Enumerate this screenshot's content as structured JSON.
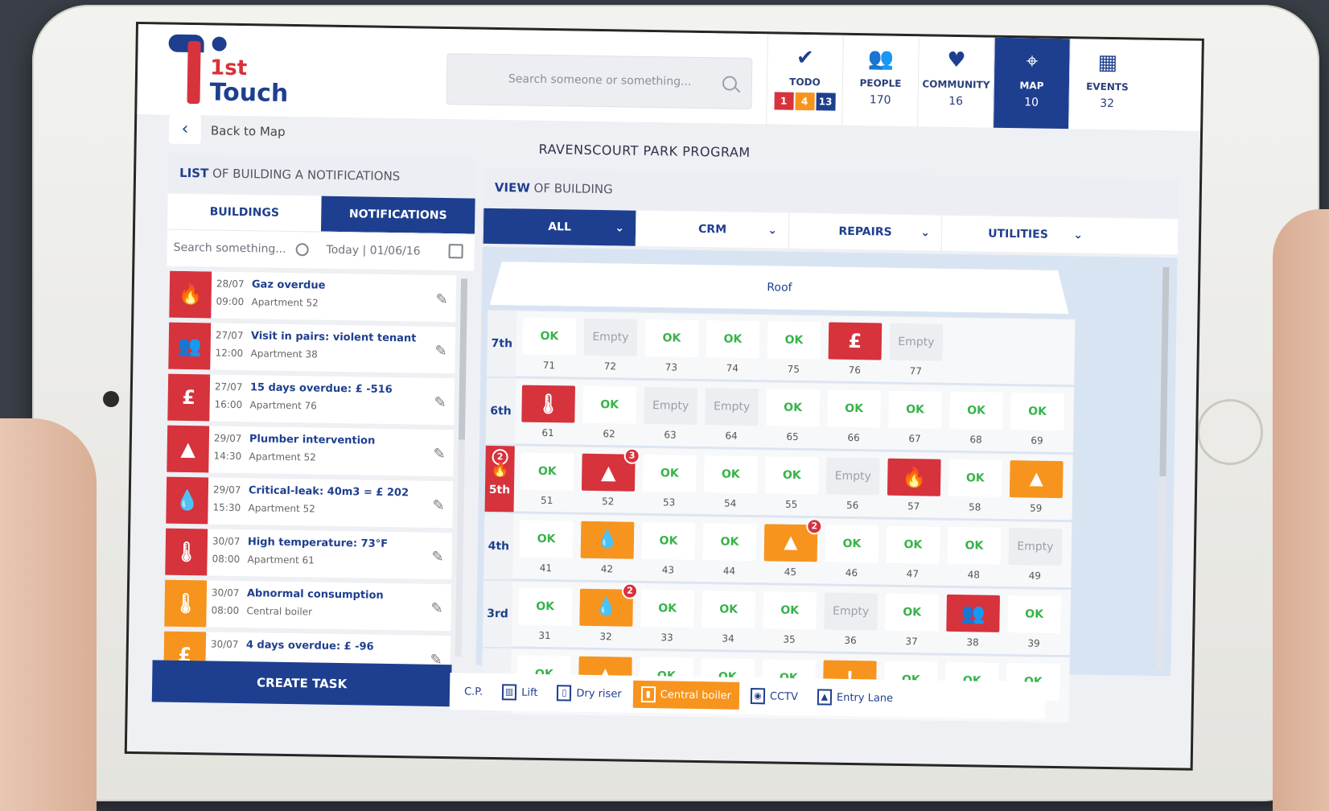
{
  "logo": {
    "line1": "1st",
    "line2": "Touch"
  },
  "search": {
    "placeholder": "Search someone or something..."
  },
  "nav": [
    {
      "label": "TODO",
      "icon": "✔",
      "badges": [
        "1",
        "4",
        "13"
      ],
      "badge_colors": [
        "#d6333d",
        "#f7941d",
        "#1e3f8f"
      ]
    },
    {
      "label": "PEOPLE",
      "icon": "👥",
      "count": "170"
    },
    {
      "label": "COMMUNITY",
      "icon": "♥",
      "count": "16"
    },
    {
      "label": "MAP",
      "icon": "⌖",
      "count": "10"
    },
    {
      "label": "EVENTS",
      "icon": "▦",
      "count": "32"
    }
  ],
  "back": {
    "label": "Back to Map",
    "icon": "‹"
  },
  "program_title": "RAVENSCOURT PARK PROGRAM",
  "left": {
    "title_bold": "LIST",
    "title_rest": " OF BUILDING A NOTIFICATIONS",
    "tabs": [
      "BUILDINGS",
      "NOTIFICATIONS"
    ],
    "search_placeholder": "Search something...",
    "date": "Today | 01/06/16",
    "notifications": [
      {
        "icon": "🔥",
        "color": "#d6333d",
        "date": "28/07",
        "time": "09:00",
        "title": "Gaz overdue",
        "location": "Apartment 52"
      },
      {
        "icon": "👥",
        "color": "#d6333d",
        "date": "27/07",
        "time": "12:00",
        "title": "Visit in pairs: violent tenant",
        "location": "Apartment 38"
      },
      {
        "icon": "£",
        "color": "#d6333d",
        "date": "27/07",
        "time": "16:00",
        "title": "15 days overdue: £ -516",
        "location": "Apartment 76"
      },
      {
        "icon": "▲",
        "color": "#d6333d",
        "date": "29/07",
        "time": "14:30",
        "title": "Plumber intervention",
        "location": "Apartment 52"
      },
      {
        "icon": "💧",
        "color": "#d6333d",
        "date": "29/07",
        "time": "15:30",
        "title": "Critical-leak: 40m3 = £ 202",
        "location": "Apartment 52"
      },
      {
        "icon": "🌡",
        "color": "#d6333d",
        "date": "30/07",
        "time": "08:00",
        "title": "High temperature: 73°F",
        "location": "Apartment 61"
      },
      {
        "icon": "🌡",
        "color": "#f7941d",
        "date": "30/07",
        "time": "08:00",
        "title": "Abnormal consumption",
        "location": "Central boiler"
      },
      {
        "icon": "£",
        "color": "#f7941d",
        "date": "30/07",
        "time": "",
        "title": "4 days overdue: £ -96",
        "location": ""
      }
    ],
    "create_label": "CREATE TASK"
  },
  "right": {
    "title_bold": "VIEW",
    "title_rest": " OF BUILDING",
    "filters": [
      "ALL",
      "CRM",
      "REPAIRS",
      "UTILITIES"
    ],
    "roof_label": "Roof",
    "floors": [
      {
        "label": "7th",
        "apartments": [
          {
            "num": "71",
            "status": "OK"
          },
          {
            "num": "72",
            "status": "Empty"
          },
          {
            "num": "73",
            "status": "OK"
          },
          {
            "num": "74",
            "status": "OK"
          },
          {
            "num": "75",
            "status": "OK"
          },
          {
            "num": "76",
            "status": "alert",
            "icon": "£",
            "color": "red"
          },
          {
            "num": "77",
            "status": "Empty"
          }
        ]
      },
      {
        "label": "6th",
        "apartments": [
          {
            "num": "61",
            "status": "alert",
            "icon": "🌡",
            "color": "red"
          },
          {
            "num": "62",
            "status": "OK"
          },
          {
            "num": "63",
            "status": "Empty"
          },
          {
            "num": "64",
            "status": "Empty"
          },
          {
            "num": "65",
            "status": "OK"
          },
          {
            "num": "66",
            "status": "OK"
          },
          {
            "num": "67",
            "status": "OK"
          },
          {
            "num": "68",
            "status": "OK"
          },
          {
            "num": "69",
            "status": "OK"
          }
        ]
      },
      {
        "label": "5th",
        "alert": true,
        "badge": "2",
        "icon": "🔥",
        "apartments": [
          {
            "num": "51",
            "status": "OK"
          },
          {
            "num": "52",
            "status": "alert",
            "icon": "▲",
            "color": "red",
            "badge": "3"
          },
          {
            "num": "53",
            "status": "OK"
          },
          {
            "num": "54",
            "status": "OK"
          },
          {
            "num": "55",
            "status": "OK"
          },
          {
            "num": "56",
            "status": "Empty"
          },
          {
            "num": "57",
            "status": "alert",
            "icon": "🔥",
            "color": "red"
          },
          {
            "num": "58",
            "status": "OK"
          },
          {
            "num": "59",
            "status": "alert",
            "icon": "▲",
            "color": "orange"
          }
        ]
      },
      {
        "label": "4th",
        "apartments": [
          {
            "num": "41",
            "status": "OK"
          },
          {
            "num": "42",
            "status": "alert",
            "icon": "💧",
            "color": "orange"
          },
          {
            "num": "43",
            "status": "OK"
          },
          {
            "num": "44",
            "status": "OK"
          },
          {
            "num": "45",
            "status": "alert",
            "icon": "▲",
            "color": "orange",
            "badge": "2"
          },
          {
            "num": "46",
            "status": "OK"
          },
          {
            "num": "47",
            "status": "OK"
          },
          {
            "num": "48",
            "status": "OK"
          },
          {
            "num": "49",
            "status": "Empty"
          }
        ]
      },
      {
        "label": "3rd",
        "apartments": [
          {
            "num": "31",
            "status": "OK"
          },
          {
            "num": "32",
            "status": "alert",
            "icon": "💧",
            "color": "orange",
            "badge": "2"
          },
          {
            "num": "33",
            "status": "OK"
          },
          {
            "num": "34",
            "status": "OK"
          },
          {
            "num": "35",
            "status": "OK"
          },
          {
            "num": "36",
            "status": "Empty"
          },
          {
            "num": "37",
            "status": "OK"
          },
          {
            "num": "38",
            "status": "alert",
            "icon": "👥",
            "color": "red"
          },
          {
            "num": "39",
            "status": "OK"
          }
        ]
      },
      {
        "label": "",
        "apartments": [
          {
            "num": "",
            "status": "OK"
          },
          {
            "num": "",
            "status": "alert",
            "icon": "▲",
            "color": "orange"
          },
          {
            "num": "",
            "status": "OK"
          },
          {
            "num": "",
            "status": "OK"
          },
          {
            "num": "",
            "status": "OK"
          },
          {
            "num": "",
            "status": "alert",
            "icon": "!",
            "color": "orange"
          },
          {
            "num": "",
            "status": "OK"
          },
          {
            "num": "",
            "status": "OK"
          },
          {
            "num": "",
            "status": "OK"
          }
        ]
      }
    ],
    "legend": [
      {
        "label": "C.P.",
        "icon": "",
        "active": false
      },
      {
        "label": "Lift",
        "icon": "▥",
        "active": false
      },
      {
        "label": "Dry riser",
        "icon": "▯",
        "active": false
      },
      {
        "label": "Central boiler",
        "icon": "▮",
        "active": true
      },
      {
        "label": "CCTV",
        "icon": "◉",
        "active": false
      },
      {
        "label": "Entry Lane",
        "icon": "▲",
        "active": false
      }
    ]
  },
  "colors": {
    "brand_blue": "#1e3f8f",
    "brand_red": "#d6333d",
    "warning_orange": "#f7941d",
    "ok_green": "#37b34a"
  }
}
